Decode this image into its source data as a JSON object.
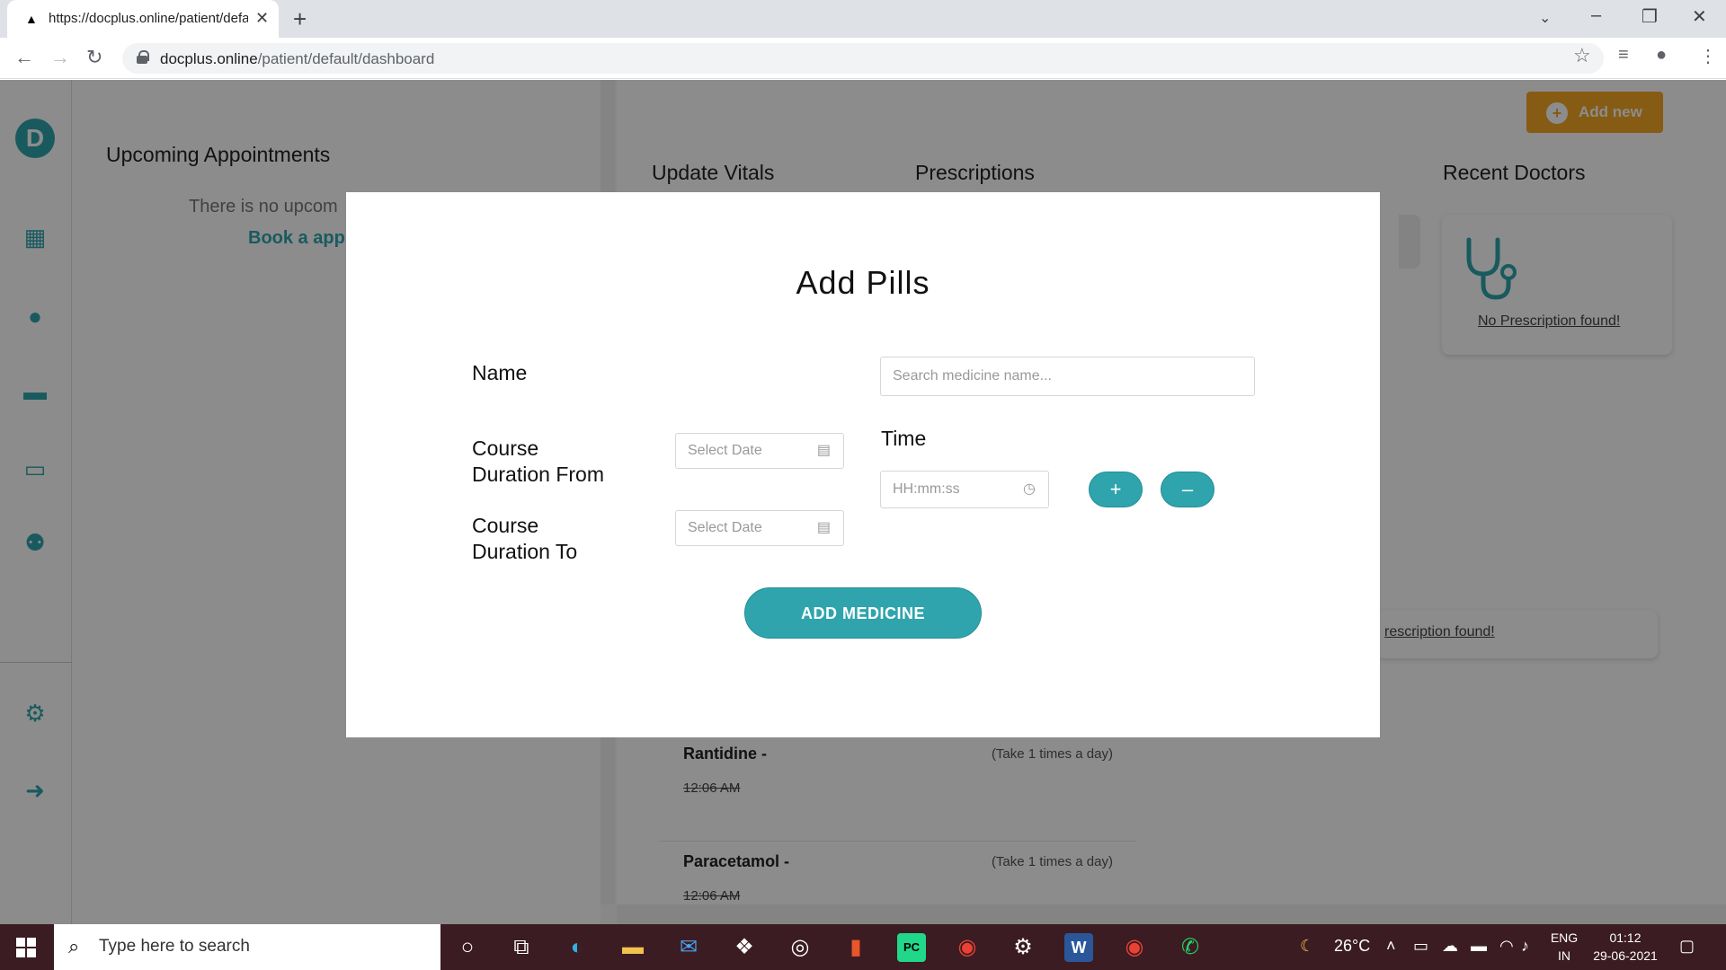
{
  "browser": {
    "tab_title": "https://docplus.online/patient/default/dashboard",
    "url_domain": "docplus.online",
    "url_path": "/patient/default/dashboard"
  },
  "left_panel": {
    "title": "Upcoming Appointments",
    "empty_text": "There is no upcom",
    "book_link": "Book a app"
  },
  "main": {
    "add_new_label": "Add new",
    "sections": [
      "Update Vitals",
      "Prescriptions",
      "Recent Doctors"
    ],
    "no_prescription": "No Prescription found!",
    "no_prescription_2": "rescription found!",
    "pills": [
      {
        "name": "Rantidine -",
        "frequency": "(Take 1 times a day)",
        "time": "12:06 AM"
      },
      {
        "name": "Paracetamol -",
        "frequency": "(Take 1 times a day)",
        "time": "12:06 AM"
      }
    ]
  },
  "modal": {
    "title": "Add Pills",
    "name_label": "Name",
    "name_placeholder": "Search medicine name...",
    "from_label_1": "Course",
    "from_label_2": "Duration From",
    "to_label_1": "Course",
    "to_label_2": "Duration To",
    "date_placeholder": "Select Date",
    "time_label": "Time",
    "time_placeholder": "HH:mm:ss",
    "add_time_symbol": "+",
    "remove_time_symbol": "–",
    "submit_label": "ADD MEDICINE"
  },
  "taskbar": {
    "search_placeholder": "Type here to search",
    "weather": "26°C",
    "lang_1": "ENG",
    "lang_2": "IN",
    "time": "01:12",
    "date": "29-06-2021"
  },
  "colors": {
    "accent": "#2fa4ad",
    "add_new": "#f5a623"
  }
}
